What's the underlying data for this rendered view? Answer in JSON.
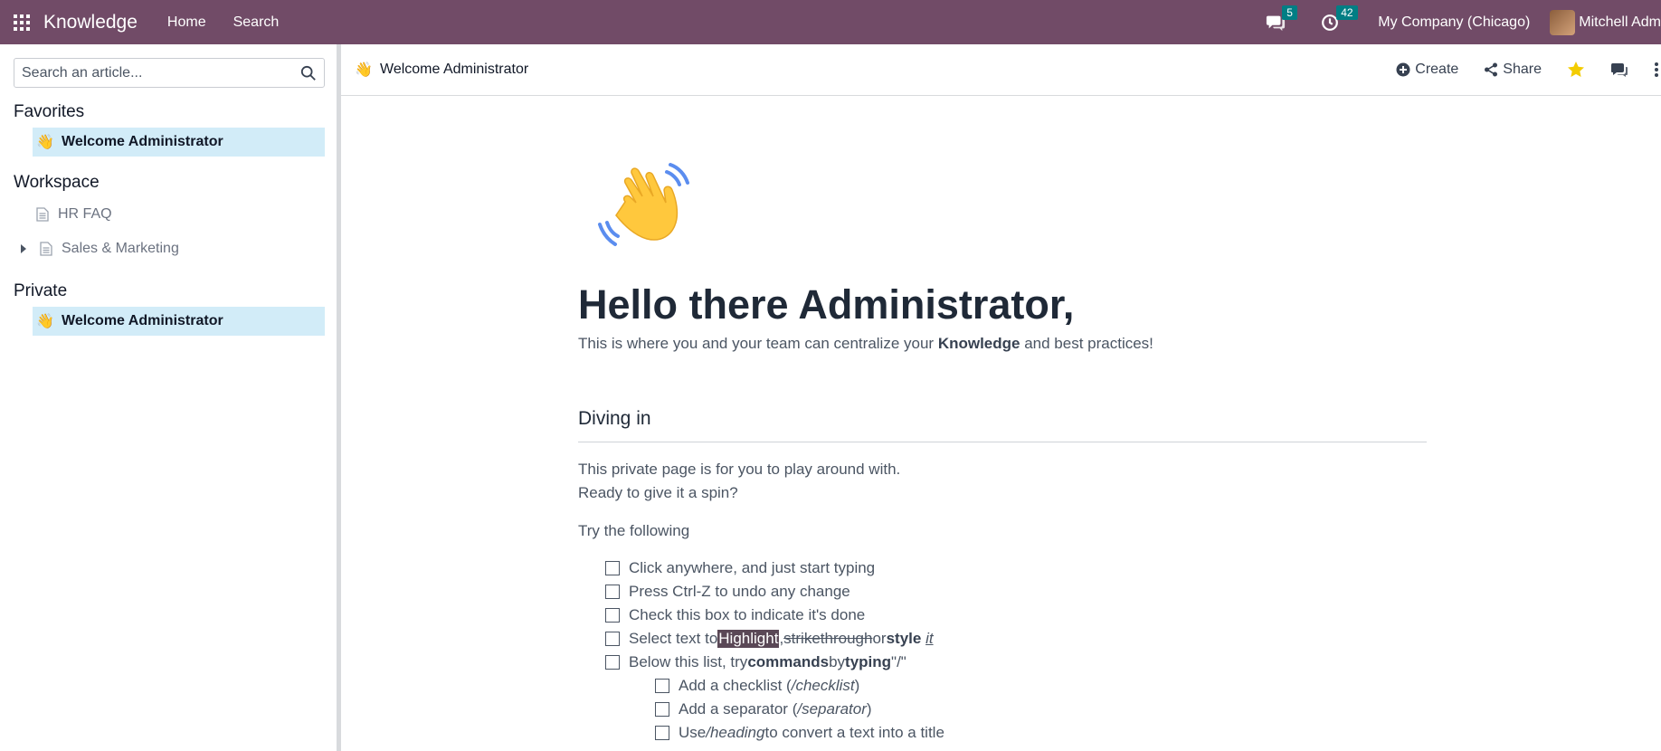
{
  "navbar": {
    "app_name": "Knowledge",
    "menu": [
      "Home",
      "Search"
    ],
    "messages_count": "5",
    "activities_count": "42",
    "company": "My Company (Chicago)",
    "user": "Mitchell Adm"
  },
  "sidebar": {
    "search_placeholder": "Search an article...",
    "favorites_title": "Favorites",
    "favorites": [
      {
        "emoji": "👋",
        "label": "Welcome Administrator"
      }
    ],
    "workspace_title": "Workspace",
    "workspace": [
      {
        "label": "HR FAQ"
      },
      {
        "label": "Sales & Marketing"
      }
    ],
    "private_title": "Private",
    "private": [
      {
        "emoji": "👋",
        "label": "Welcome Administrator"
      }
    ]
  },
  "header": {
    "emoji": "👋",
    "title": "Welcome Administrator",
    "create": "Create",
    "share": "Share"
  },
  "article": {
    "heading": "Hello there Administrator,",
    "lead_before": "This is where you and your team can centralize your ",
    "lead_bold": "Knowledge",
    "lead_after": " and best practices!",
    "section": "Diving in",
    "para1": "This private page is for you to play around with.",
    "para2": "Ready to give it a spin?",
    "para3": "Try the following",
    "c1": "Click anywhere, and just start typing",
    "c2": "Press Ctrl-Z to undo any change",
    "c3": "Check this box to indicate it's done",
    "c4": {
      "a": "Select text to ",
      "hl": "Highlight",
      "comma": ", ",
      "strike": "strikethrough",
      "or": " or ",
      "style": "style",
      "it": "it"
    },
    "c5": {
      "a": "Below this list, try ",
      "commands": "commands",
      "by": " by ",
      "typing": "typing",
      "slash": " \"/\""
    },
    "s1": {
      "a": "Add a checklist (",
      "i": "/checklist",
      "b": ")"
    },
    "s2": {
      "a": "Add a separator (",
      "i": "/separator",
      "b": ")"
    },
    "s3": {
      "a": "Use ",
      "i": "/heading",
      "b": " to convert a text into a title"
    }
  },
  "colors": {
    "brand": "#714B67",
    "badge": "#017E84",
    "active_item": "#d2ecf8",
    "star": "#f3cc00"
  }
}
